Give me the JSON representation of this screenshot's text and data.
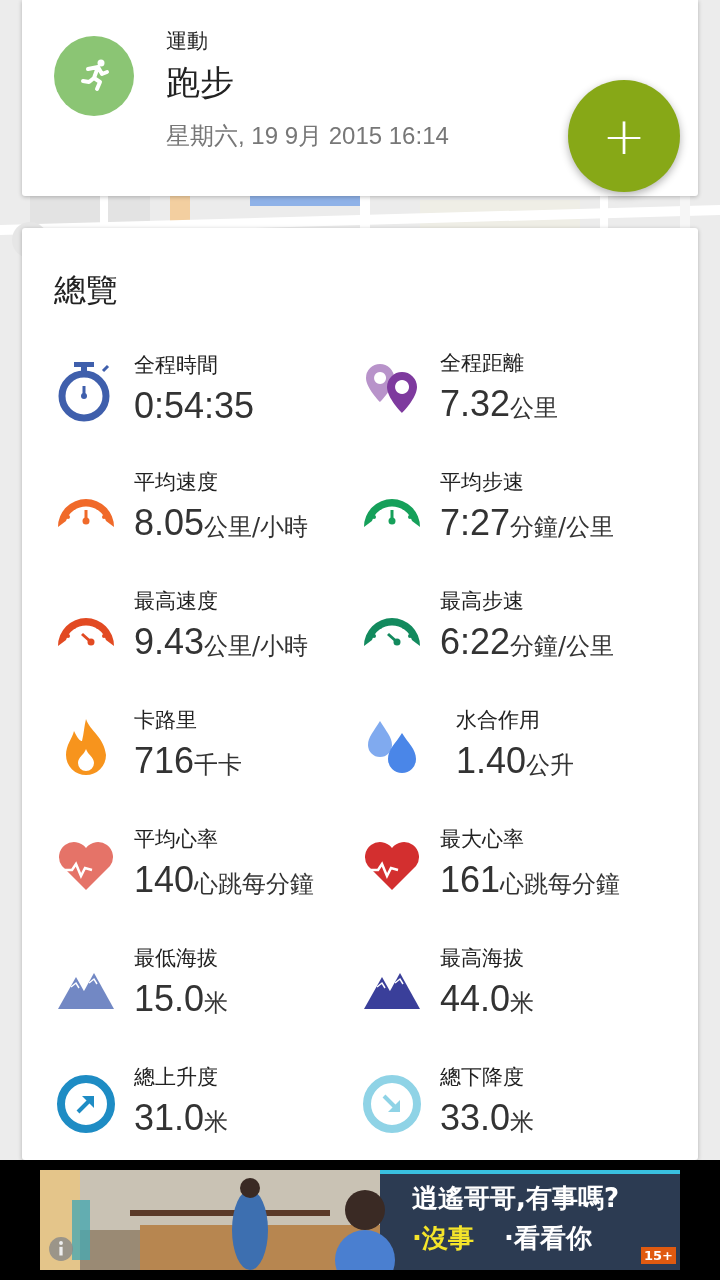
{
  "header": {
    "category": "運動",
    "activity": "跑步",
    "datetime": "星期六, 19 9月 2015 16:14",
    "add_button": "+"
  },
  "overview": {
    "title": "總覽",
    "stats": [
      {
        "kind": "stopwatch",
        "color": "#3f5fac",
        "label": "全程時間",
        "value": "0:54:35"
      },
      {
        "kind": "pins",
        "color": "#7e3a9e",
        "label": "全程距離",
        "value": "7.32",
        "unit": "公里"
      },
      {
        "kind": "gauge",
        "color": "#f06a2a",
        "label": "平均速度",
        "value": "8.05",
        "unit": "公里/小時"
      },
      {
        "kind": "gauge",
        "color": "#16a05a",
        "label": "平均步速",
        "value": "7:27",
        "unit": "分鐘/公里"
      },
      {
        "kind": "maxgauge",
        "color": "#e24a22",
        "label": "最高速度",
        "value": "9.43",
        "unit": "公里/小時"
      },
      {
        "kind": "maxgauge",
        "color": "#138a5e",
        "label": "最高步速",
        "value": "6:22",
        "unit": "分鐘/公里"
      },
      {
        "kind": "flame",
        "color": "#f7941d",
        "label": "卡路里",
        "value": "716",
        "unit": "千卡"
      },
      {
        "kind": "drops",
        "color": "#4a86e8",
        "label": "水合作用",
        "value": "1.40",
        "unit": "公升"
      },
      {
        "kind": "heart",
        "color": "#e57368",
        "label": "平均心率",
        "value": "140",
        "unit": "心跳每分鐘"
      },
      {
        "kind": "heart",
        "color": "#d32f2f",
        "label": "最大心率",
        "value": "161",
        "unit": "心跳每分鐘"
      },
      {
        "kind": "mountains",
        "color": "#7288c4",
        "label": "最低海拔",
        "value": "15.0",
        "unit": "米"
      },
      {
        "kind": "mountains",
        "color": "#3a3f9a",
        "label": "最高海拔",
        "value": "44.0",
        "unit": "米"
      },
      {
        "kind": "ascent",
        "color": "#1e8cc4",
        "label": "總上升度",
        "value": "31.0",
        "unit": "米"
      },
      {
        "kind": "descent",
        "color": "#8fd3e6",
        "label": "總下降度",
        "value": "33.0",
        "unit": "米"
      }
    ]
  },
  "ad": {
    "kind": "picture",
    "headline": "逍遙哥哥,有事嗎?",
    "options": [
      "·沒事",
      "·看看你"
    ],
    "rating": "15+"
  }
}
